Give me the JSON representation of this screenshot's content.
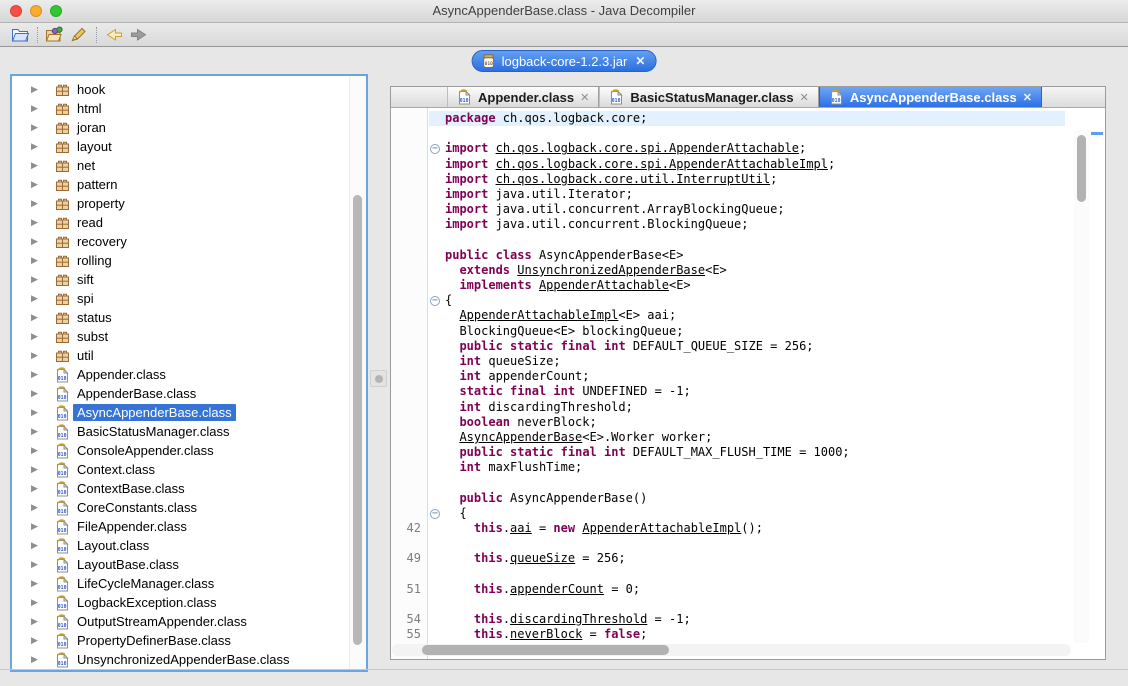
{
  "window": {
    "title": "AsyncAppenderBase.class - Java Decompiler"
  },
  "toolbar": {
    "icons": [
      "open-folder-icon",
      "open-type-icon",
      "search-icon",
      "back-arrow-icon",
      "forward-arrow-icon"
    ]
  },
  "archive_tab": {
    "label": "logback-core-1.2.3.jar",
    "icon": "jar-icon",
    "close_label": "✕"
  },
  "tree": {
    "items": [
      {
        "label": "hook",
        "type": "package"
      },
      {
        "label": "html",
        "type": "package"
      },
      {
        "label": "joran",
        "type": "package"
      },
      {
        "label": "layout",
        "type": "package"
      },
      {
        "label": "net",
        "type": "package"
      },
      {
        "label": "pattern",
        "type": "package"
      },
      {
        "label": "property",
        "type": "package"
      },
      {
        "label": "read",
        "type": "package"
      },
      {
        "label": "recovery",
        "type": "package"
      },
      {
        "label": "rolling",
        "type": "package"
      },
      {
        "label": "sift",
        "type": "package"
      },
      {
        "label": "spi",
        "type": "package"
      },
      {
        "label": "status",
        "type": "package"
      },
      {
        "label": "subst",
        "type": "package"
      },
      {
        "label": "util",
        "type": "package"
      },
      {
        "label": "Appender.class",
        "type": "class"
      },
      {
        "label": "AppenderBase.class",
        "type": "class"
      },
      {
        "label": "AsyncAppenderBase.class",
        "type": "class",
        "selected": true
      },
      {
        "label": "BasicStatusManager.class",
        "type": "class"
      },
      {
        "label": "ConsoleAppender.class",
        "type": "class"
      },
      {
        "label": "Context.class",
        "type": "class"
      },
      {
        "label": "ContextBase.class",
        "type": "class"
      },
      {
        "label": "CoreConstants.class",
        "type": "class"
      },
      {
        "label": "FileAppender.class",
        "type": "class"
      },
      {
        "label": "Layout.class",
        "type": "class"
      },
      {
        "label": "LayoutBase.class",
        "type": "class"
      },
      {
        "label": "LifeCycleManager.class",
        "type": "class"
      },
      {
        "label": "LogbackException.class",
        "type": "class"
      },
      {
        "label": "OutputStreamAppender.class",
        "type": "class"
      },
      {
        "label": "PropertyDefinerBase.class",
        "type": "class"
      },
      {
        "label": "UnsynchronizedAppenderBase.class",
        "type": "class"
      }
    ]
  },
  "editor": {
    "tabs": [
      {
        "label": "Appender.class",
        "active": false
      },
      {
        "label": "BasicStatusManager.class",
        "active": false
      },
      {
        "label": "AsyncAppenderBase.class",
        "active": true
      }
    ]
  },
  "code": {
    "lines": [
      {
        "hl": true,
        "tokens": [
          [
            "k",
            "package"
          ],
          [
            "p",
            " ch.qos.logback.core;"
          ]
        ]
      },
      {
        "tokens": []
      },
      {
        "fold": true,
        "tokens": [
          [
            "k",
            "import"
          ],
          [
            "p",
            " "
          ],
          [
            "u",
            "ch.qos.logback.core.spi.AppenderAttachable"
          ],
          [
            "p",
            ";"
          ]
        ]
      },
      {
        "tokens": [
          [
            "k",
            "import"
          ],
          [
            "p",
            " "
          ],
          [
            "u",
            "ch.qos.logback.core.spi.AppenderAttachableImpl"
          ],
          [
            "p",
            ";"
          ]
        ]
      },
      {
        "tokens": [
          [
            "k",
            "import"
          ],
          [
            "p",
            " "
          ],
          [
            "u",
            "ch.qos.logback.core.util.InterruptUtil"
          ],
          [
            "p",
            ";"
          ]
        ]
      },
      {
        "tokens": [
          [
            "k",
            "import"
          ],
          [
            "p",
            " java.util.Iterator;"
          ]
        ]
      },
      {
        "tokens": [
          [
            "k",
            "import"
          ],
          [
            "p",
            " java.util.concurrent.ArrayBlockingQueue;"
          ]
        ]
      },
      {
        "tokens": [
          [
            "k",
            "import"
          ],
          [
            "p",
            " java.util.concurrent.BlockingQueue;"
          ]
        ]
      },
      {
        "tokens": []
      },
      {
        "tokens": [
          [
            "k",
            "public"
          ],
          [
            "p",
            " "
          ],
          [
            "k",
            "class"
          ],
          [
            "p",
            " AsyncAppenderBase<E>"
          ]
        ]
      },
      {
        "tokens": [
          [
            "p",
            "  "
          ],
          [
            "k",
            "extends"
          ],
          [
            "p",
            " "
          ],
          [
            "u",
            "UnsynchronizedAppenderBase"
          ],
          [
            "p",
            "<E>"
          ]
        ]
      },
      {
        "tokens": [
          [
            "p",
            "  "
          ],
          [
            "k",
            "implements"
          ],
          [
            "p",
            " "
          ],
          [
            "u",
            "AppenderAttachable"
          ],
          [
            "p",
            "<E>"
          ]
        ]
      },
      {
        "fold": true,
        "tokens": [
          [
            "p",
            "{"
          ]
        ]
      },
      {
        "tokens": [
          [
            "p",
            "  "
          ],
          [
            "u",
            "AppenderAttachableImpl"
          ],
          [
            "p",
            "<E> aai;"
          ]
        ]
      },
      {
        "tokens": [
          [
            "p",
            "  BlockingQueue<E> blockingQueue;"
          ]
        ]
      },
      {
        "tokens": [
          [
            "p",
            "  "
          ],
          [
            "k",
            "public"
          ],
          [
            "p",
            " "
          ],
          [
            "k",
            "static"
          ],
          [
            "p",
            " "
          ],
          [
            "k",
            "final"
          ],
          [
            "p",
            " "
          ],
          [
            "k",
            "int"
          ],
          [
            "p",
            " DEFAULT_QUEUE_SIZE = 256;"
          ]
        ]
      },
      {
        "tokens": [
          [
            "p",
            "  "
          ],
          [
            "k",
            "int"
          ],
          [
            "p",
            " queueSize;"
          ]
        ]
      },
      {
        "tokens": [
          [
            "p",
            "  "
          ],
          [
            "k",
            "int"
          ],
          [
            "p",
            " appenderCount;"
          ]
        ]
      },
      {
        "tokens": [
          [
            "p",
            "  "
          ],
          [
            "k",
            "static"
          ],
          [
            "p",
            " "
          ],
          [
            "k",
            "final"
          ],
          [
            "p",
            " "
          ],
          [
            "k",
            "int"
          ],
          [
            "p",
            " UNDEFINED = -1;"
          ]
        ]
      },
      {
        "tokens": [
          [
            "p",
            "  "
          ],
          [
            "k",
            "int"
          ],
          [
            "p",
            " discardingThreshold;"
          ]
        ]
      },
      {
        "tokens": [
          [
            "p",
            "  "
          ],
          [
            "k",
            "boolean"
          ],
          [
            "p",
            " neverBlock;"
          ]
        ]
      },
      {
        "tokens": [
          [
            "p",
            "  "
          ],
          [
            "u",
            "AsyncAppenderBase"
          ],
          [
            "p",
            "<E>.Worker worker;"
          ]
        ]
      },
      {
        "tokens": [
          [
            "p",
            "  "
          ],
          [
            "k",
            "public"
          ],
          [
            "p",
            " "
          ],
          [
            "k",
            "static"
          ],
          [
            "p",
            " "
          ],
          [
            "k",
            "final"
          ],
          [
            "p",
            " "
          ],
          [
            "k",
            "int"
          ],
          [
            "p",
            " DEFAULT_MAX_FLUSH_TIME = 1000;"
          ]
        ]
      },
      {
        "tokens": [
          [
            "p",
            "  "
          ],
          [
            "k",
            "int"
          ],
          [
            "p",
            " maxFlushTime;"
          ]
        ]
      },
      {
        "tokens": []
      },
      {
        "tokens": [
          [
            "p",
            "  "
          ],
          [
            "k",
            "public"
          ],
          [
            "p",
            " AsyncAppenderBase()"
          ]
        ]
      },
      {
        "fold": true,
        "tokens": [
          [
            "p",
            "  {"
          ]
        ]
      },
      {
        "num": "42",
        "tokens": [
          [
            "p",
            "    "
          ],
          [
            "k",
            "this"
          ],
          [
            "p",
            "."
          ],
          [
            "u",
            "aai"
          ],
          [
            "p",
            " = "
          ],
          [
            "k",
            "new"
          ],
          [
            "p",
            " "
          ],
          [
            "u",
            "AppenderAttachableImpl"
          ],
          [
            "p",
            "();"
          ]
        ]
      },
      {
        "tokens": []
      },
      {
        "num": "49",
        "tokens": [
          [
            "p",
            "    "
          ],
          [
            "k",
            "this"
          ],
          [
            "p",
            "."
          ],
          [
            "u",
            "queueSize"
          ],
          [
            "p",
            " = 256;"
          ]
        ]
      },
      {
        "tokens": []
      },
      {
        "num": "51",
        "tokens": [
          [
            "p",
            "    "
          ],
          [
            "k",
            "this"
          ],
          [
            "p",
            "."
          ],
          [
            "u",
            "appenderCount"
          ],
          [
            "p",
            " = 0;"
          ]
        ]
      },
      {
        "tokens": []
      },
      {
        "num": "54",
        "tokens": [
          [
            "p",
            "    "
          ],
          [
            "k",
            "this"
          ],
          [
            "p",
            "."
          ],
          [
            "u",
            "discardingThreshold"
          ],
          [
            "p",
            " = -1;"
          ]
        ]
      },
      {
        "num": "55",
        "tokens": [
          [
            "p",
            "    "
          ],
          [
            "k",
            "this"
          ],
          [
            "p",
            "."
          ],
          [
            "u",
            "neverBlock"
          ],
          [
            "p",
            " = "
          ],
          [
            "k",
            "false"
          ],
          [
            "p",
            ";"
          ]
        ]
      }
    ]
  },
  "colors": {
    "accent_blue": "#2d6ede",
    "keyword": "#7f0055",
    "selection_blue": "#3574d4",
    "line_highlight": "#e3f0fd",
    "line_number_gray": "#7d7d7d"
  }
}
